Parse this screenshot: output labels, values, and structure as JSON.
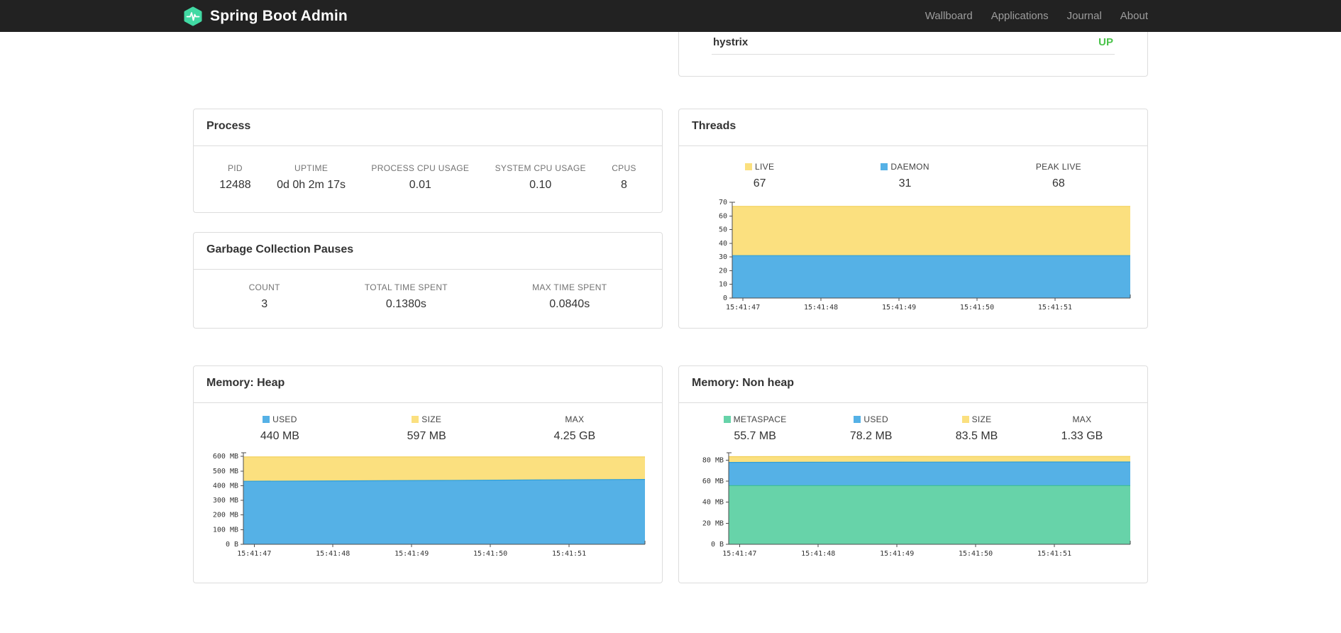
{
  "navbar": {
    "brand": "Spring Boot Admin",
    "items": [
      {
        "label": "Wallboard"
      },
      {
        "label": "Applications"
      },
      {
        "label": "Journal"
      },
      {
        "label": "About"
      }
    ]
  },
  "colors": {
    "brand_accent": "#41d9a3",
    "status_up": "#4bc34b",
    "area_yellow": "#fbe07f",
    "area_blue": "#55b1e6",
    "area_green": "#67d3a9"
  },
  "status_panel": {
    "service": "hystrix",
    "status": "UP"
  },
  "process": {
    "title": "Process",
    "metrics": [
      {
        "label": "PID",
        "value": "12488"
      },
      {
        "label": "UPTIME",
        "value": "0d 0h 2m 17s"
      },
      {
        "label": "PROCESS CPU USAGE",
        "value": "0.01"
      },
      {
        "label": "SYSTEM CPU USAGE",
        "value": "0.10"
      },
      {
        "label": "CPUS",
        "value": "8"
      }
    ]
  },
  "gc": {
    "title": "Garbage Collection Pauses",
    "metrics": [
      {
        "label": "COUNT",
        "value": "3"
      },
      {
        "label": "TOTAL TIME SPENT",
        "value": "0.1380s"
      },
      {
        "label": "MAX TIME SPENT",
        "value": "0.0840s"
      }
    ]
  },
  "threads": {
    "title": "Threads",
    "legend": [
      {
        "label": "LIVE",
        "value": "67",
        "color": "#fbe07f"
      },
      {
        "label": "DAEMON",
        "value": "31",
        "color": "#55b1e6"
      },
      {
        "label": "PEAK LIVE",
        "value": "68",
        "color": ""
      }
    ]
  },
  "heap": {
    "title": "Memory: Heap",
    "legend": [
      {
        "label": "USED",
        "value": "440 MB",
        "color": "#55b1e6"
      },
      {
        "label": "SIZE",
        "value": "597 MB",
        "color": "#fbe07f"
      },
      {
        "label": "MAX",
        "value": "4.25 GB",
        "color": ""
      }
    ]
  },
  "nonheap": {
    "title": "Memory: Non heap",
    "legend": [
      {
        "label": "METASPACE",
        "value": "55.7 MB",
        "color": "#67d3a9"
      },
      {
        "label": "USED",
        "value": "78.2 MB",
        "color": "#55b1e6"
      },
      {
        "label": "SIZE",
        "value": "83.5 MB",
        "color": "#fbe07f"
      },
      {
        "label": "MAX",
        "value": "1.33 GB",
        "color": ""
      }
    ]
  },
  "chart_data": [
    {
      "type": "area",
      "title": "Threads",
      "x": [
        "15:41:47",
        "15:41:48",
        "15:41:49",
        "15:41:50",
        "15:41:51"
      ],
      "ylim": [
        0,
        70
      ],
      "grid": false,
      "legend_position": "top",
      "yticks": [
        {
          "v": 0,
          "label": "0"
        },
        {
          "v": 10,
          "label": "10"
        },
        {
          "v": 20,
          "label": "20"
        },
        {
          "v": 30,
          "label": "30"
        },
        {
          "v": 40,
          "label": "40"
        },
        {
          "v": 50,
          "label": "50"
        },
        {
          "v": 60,
          "label": "60"
        },
        {
          "v": 70,
          "label": "70"
        }
      ],
      "series": [
        {
          "name": "LIVE",
          "color": "#fbe07f",
          "edge": "#f2cf55",
          "values": [
            67,
            67,
            67,
            67,
            67
          ]
        },
        {
          "name": "DAEMON",
          "color": "#55b1e6",
          "edge": "#2e9fd8",
          "values": [
            31,
            31,
            31,
            31,
            31
          ]
        }
      ]
    },
    {
      "type": "area",
      "title": "Memory: Heap",
      "x": [
        "15:41:47",
        "15:41:48",
        "15:41:49",
        "15:41:50",
        "15:41:51"
      ],
      "ylim": [
        0,
        625
      ],
      "grid": false,
      "legend_position": "top",
      "yticks": [
        {
          "v": 0,
          "label": "0 B"
        },
        {
          "v": 100,
          "label": "100 MB"
        },
        {
          "v": 200,
          "label": "200 MB"
        },
        {
          "v": 300,
          "label": "300 MB"
        },
        {
          "v": 400,
          "label": "400 MB"
        },
        {
          "v": 500,
          "label": "500 MB"
        },
        {
          "v": 600,
          "label": "600 MB"
        }
      ],
      "series": [
        {
          "name": "SIZE",
          "color": "#fbe07f",
          "edge": "#f2cf55",
          "values": [
            597,
            597,
            597,
            597,
            597
          ]
        },
        {
          "name": "USED",
          "color": "#55b1e6",
          "edge": "#2e9fd8",
          "values": [
            430,
            433,
            436,
            440,
            443
          ]
        }
      ]
    },
    {
      "type": "area",
      "title": "Memory: Non heap",
      "x": [
        "15:41:47",
        "15:41:48",
        "15:41:49",
        "15:41:50",
        "15:41:51"
      ],
      "ylim": [
        0,
        87
      ],
      "grid": false,
      "legend_position": "top",
      "yticks": [
        {
          "v": 0,
          "label": "0 B"
        },
        {
          "v": 20,
          "label": "20 MB"
        },
        {
          "v": 40,
          "label": "40 MB"
        },
        {
          "v": 60,
          "label": "60 MB"
        },
        {
          "v": 80,
          "label": "80 MB"
        }
      ],
      "series": [
        {
          "name": "SIZE",
          "color": "#fbe07f",
          "edge": "#f2cf55",
          "values": [
            83.3,
            83.4,
            83.5,
            83.5,
            83.5
          ]
        },
        {
          "name": "USED",
          "color": "#55b1e6",
          "edge": "#2e9fd8",
          "values": [
            77.8,
            78.0,
            78.1,
            78.2,
            78.2
          ]
        },
        {
          "name": "METASPACE",
          "color": "#67d3a9",
          "edge": "#41c193",
          "values": [
            55.7,
            55.7,
            55.7,
            55.7,
            55.7
          ]
        }
      ]
    }
  ]
}
